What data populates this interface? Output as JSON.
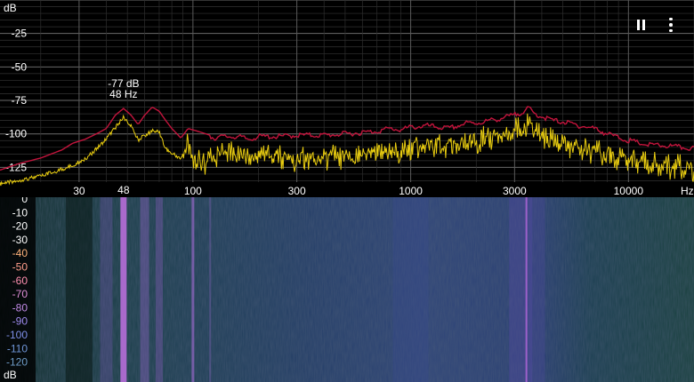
{
  "spectrum": {
    "y_unit": "dB",
    "y_ticks": [
      "-25",
      "-50",
      "-75",
      "-100",
      "-125"
    ],
    "x_unit": "Hz",
    "x_ticks": [
      "30",
      "100",
      "300",
      "1000",
      "3000",
      "10000"
    ],
    "peak": {
      "db_label": "-77 dB",
      "hz_label": "48 Hz",
      "freq_label": "48"
    }
  },
  "spectrogram": {
    "y_ticks": [
      "0",
      "-10",
      "-20",
      "-30",
      "-40",
      "-50",
      "-60",
      "-70",
      "-80",
      "-90",
      "-100",
      "-110",
      "-120"
    ],
    "y_unit": "dB",
    "tick_colors": [
      "#ffffff",
      "#ffffff",
      "#ffffff",
      "#ffffff",
      "#ffb27a",
      "#ff9d8a",
      "#ff8fb0",
      "#e08ed8",
      "#c18ae6",
      "#9c89ec",
      "#7e8fe8",
      "#7096d8",
      "#6f9cc8"
    ]
  },
  "controls": {
    "pause_icon": "pause-icon",
    "menu_icon": "more-vert-icon"
  },
  "colors": {
    "peak_trace": "#c2143c",
    "live_trace": "#e8cc10",
    "annotation": "#4aa8e8",
    "grid": "#3a3a3a"
  },
  "chart_data": {
    "type": "line",
    "x_scale": "log",
    "xlim": [
      13,
      20000
    ],
    "ylim": [
      -136,
      0
    ],
    "xlabel": "Hz",
    "ylabel": "dB",
    "grid": true,
    "series": [
      {
        "x": [
          13,
          16,
          20,
          25,
          28,
          32,
          36,
          40,
          44,
          48,
          52,
          56,
          60,
          65,
          70,
          75,
          80,
          88,
          95,
          100,
          110,
          125,
          140,
          160,
          180,
          200,
          250,
          300,
          400,
          500,
          600,
          700,
          800,
          900,
          1000,
          1200,
          1500,
          1800,
          2000,
          2500,
          3000,
          3300,
          3500,
          3700,
          4000,
          4500,
          5000,
          6000,
          7000,
          8000,
          10000,
          12000,
          15000,
          20000
        ],
        "y": [
          -127,
          -122,
          -118,
          -112,
          -107,
          -104,
          -100,
          -96,
          -86,
          -81,
          -86,
          -93,
          -86,
          -80,
          -83,
          -90,
          -96,
          -103,
          -96,
          -97,
          -99,
          -102,
          -101,
          -101,
          -103,
          -101,
          -101,
          -100,
          -100,
          -99,
          -98,
          -97,
          -95,
          -96,
          -94,
          -93,
          -95,
          -91,
          -91,
          -88,
          -85,
          -82,
          -80,
          -84,
          -86,
          -89,
          -90,
          -93,
          -95,
          -99,
          -104,
          -107,
          -108,
          -110
        ]
      },
      {
        "x": [
          13,
          16,
          20,
          25,
          28,
          32,
          36,
          40,
          44,
          48,
          52,
          56,
          60,
          65,
          70,
          75,
          80,
          88,
          95,
          100,
          110,
          125,
          140,
          160,
          180,
          200,
          250,
          300,
          400,
          500,
          600,
          700,
          800,
          900,
          1000,
          1200,
          1500,
          1800,
          2000,
          2500,
          3000,
          3300,
          3500,
          3700,
          4000,
          4500,
          5000,
          6000,
          7000,
          8000,
          10000,
          12000,
          15000,
          20000
        ],
        "y": [
          -136,
          -133,
          -130,
          -125,
          -122,
          -117,
          -110,
          -102,
          -94,
          -86,
          -93,
          -103,
          -100,
          -96,
          -97,
          -110,
          -113,
          -117,
          -102,
          -114,
          -116,
          -111,
          -109,
          -110,
          -112,
          -110,
          -112,
          -113,
          -112,
          -111,
          -110,
          -108,
          -106,
          -108,
          -104,
          -102,
          -104,
          -100,
          -99,
          -96,
          -92,
          -90,
          -88,
          -92,
          -96,
          -99,
          -101,
          -105,
          -107,
          -110,
          -113,
          -116,
          -118,
          -120
        ]
      }
    ]
  }
}
